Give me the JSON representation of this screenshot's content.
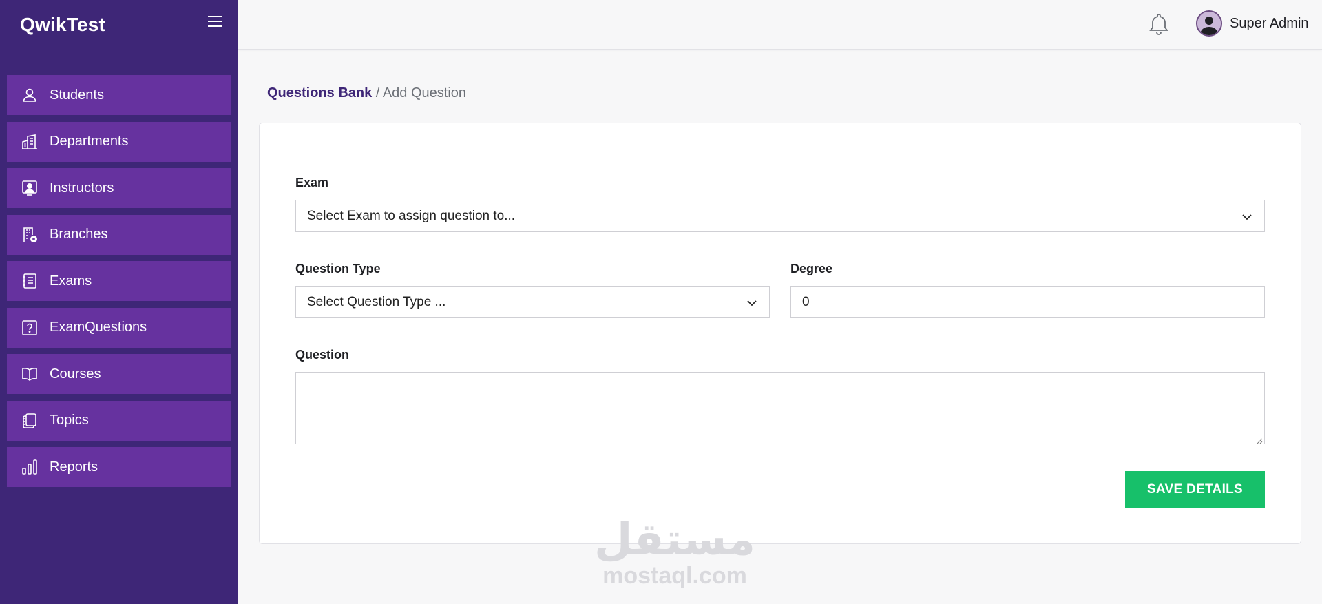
{
  "app": {
    "brand": "QwikTest"
  },
  "sidebar": {
    "items": [
      {
        "label": "Students",
        "icon": "user-icon"
      },
      {
        "label": "Departments",
        "icon": "building-icon"
      },
      {
        "label": "Instructors",
        "icon": "instructor-icon"
      },
      {
        "label": "Branches",
        "icon": "branch-building-icon"
      },
      {
        "label": "Exams",
        "icon": "exam-notebook-icon"
      },
      {
        "label": "ExamQuestions",
        "icon": "question-mark-icon"
      },
      {
        "label": "Courses",
        "icon": "open-book-icon"
      },
      {
        "label": "Topics",
        "icon": "notebook-stack-icon"
      },
      {
        "label": "Reports",
        "icon": "bar-chart-icon"
      }
    ]
  },
  "topbar": {
    "user_name": "Super Admin"
  },
  "breadcrumb": {
    "parent": "Questions Bank",
    "separator": "/",
    "current": "Add Question"
  },
  "form": {
    "exam_label": "Exam",
    "exam_value": "Select Exam to assign question to...",
    "question_type_label": "Question Type",
    "question_type_value": "Select Question Type ...",
    "degree_label": "Degree",
    "degree_value": "0",
    "question_label": "Question",
    "question_value": "",
    "save_label": "SAVE DETAILS"
  },
  "watermark": {
    "arabic": "مستقل",
    "latin": "mostaql.com"
  },
  "colors": {
    "sidebar": "#3e2677",
    "nav_item": "#66329f",
    "accent": "#3e2677",
    "save": "#17c06a"
  }
}
